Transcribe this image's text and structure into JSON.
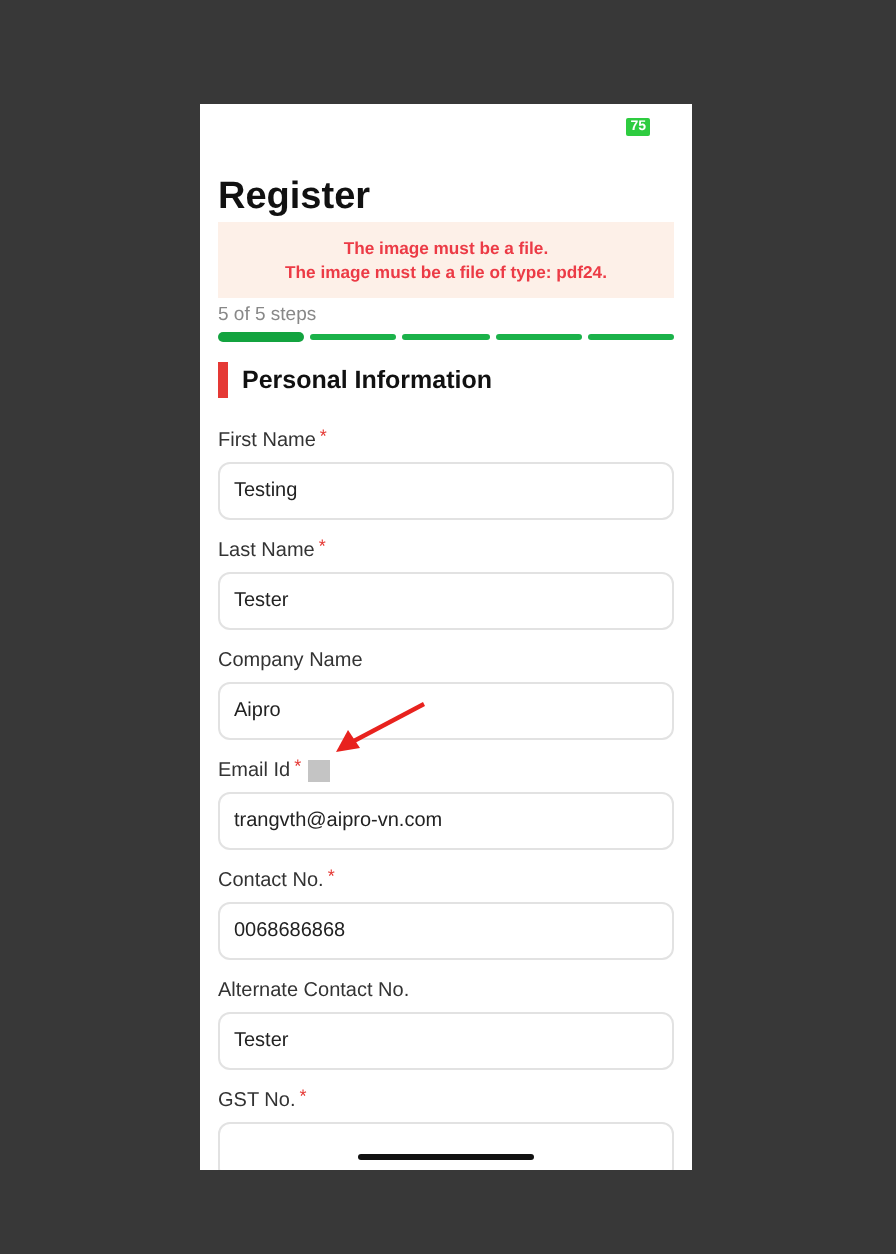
{
  "status_bar": {
    "battery": "75"
  },
  "title": "Register",
  "errors": [
    "The image must be a file.",
    "The image must be a file of type: pdf24."
  ],
  "progress": {
    "label": "5 of 5 steps",
    "steps": [
      {
        "selected": true
      },
      {
        "selected": false
      },
      {
        "selected": false
      },
      {
        "selected": false
      },
      {
        "selected": false
      }
    ]
  },
  "section": "Personal Information",
  "fields": [
    {
      "label": "First Name",
      "required_mark": "*",
      "value": "Testing"
    },
    {
      "label": "Last Name",
      "required_mark": "*",
      "value": "Tester"
    },
    {
      "label": "Company Name",
      "value": "Aipro"
    },
    {
      "label": "Email Id",
      "required_mark": "*",
      "value": "trangvth@aipro-vn.com",
      "annotated": true
    },
    {
      "label": "Contact No.",
      "required_mark": "*",
      "value": "0068686868"
    },
    {
      "label": "Alternate Contact No.",
      "value": "Tester"
    },
    {
      "label": "GST No.",
      "required_mark": "*"
    }
  ]
}
